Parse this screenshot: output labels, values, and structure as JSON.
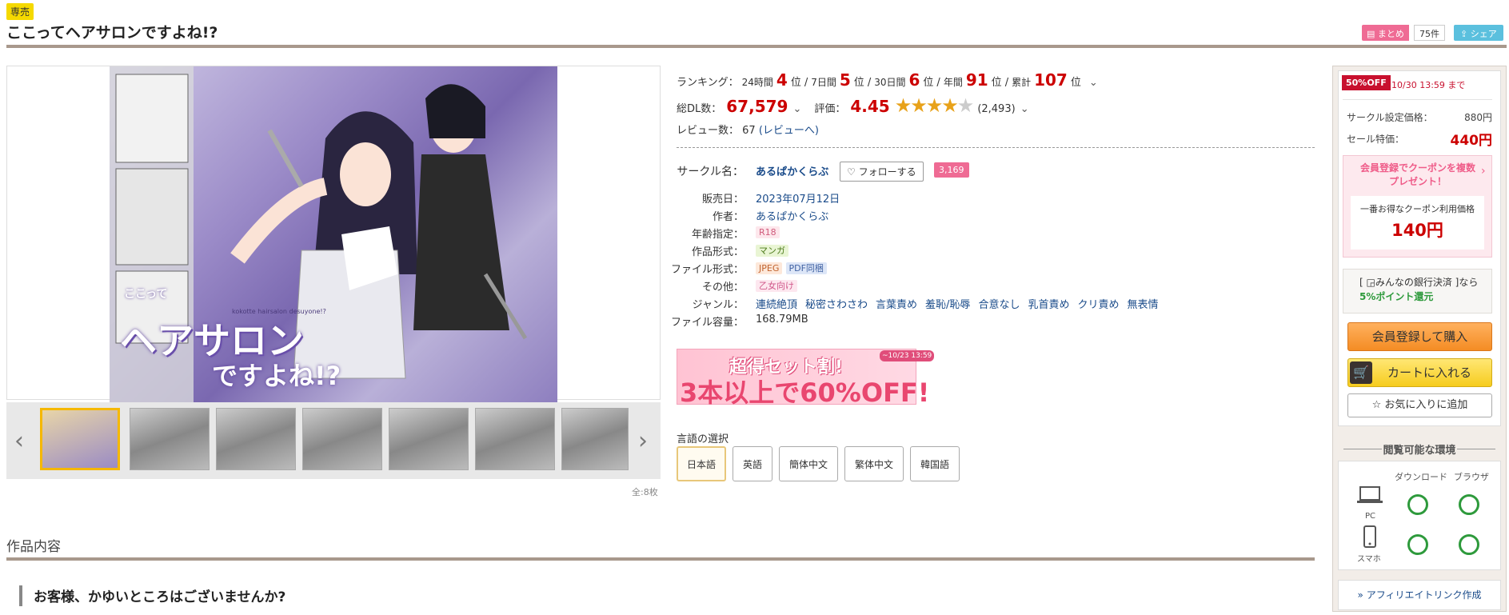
{
  "header": {
    "exclusive_badge": "専売",
    "title": "ここってヘアサロンですよね!?",
    "matome_label": "まとめ",
    "matome_count": "75件",
    "share_label": "シェア"
  },
  "gallery": {
    "cover_title_line1": "ヘアサロン",
    "cover_title_line2": "ですよね!?",
    "cover_top": "ここって",
    "cover_romaji": "kokotte hairsalon desuyone!?",
    "count_label": "全:8枚",
    "prev_icon": "chevron-left-icon",
    "next_icon": "chevron-right-icon"
  },
  "ranking": {
    "label": "ランキング：",
    "items": [
      {
        "period": "24時間",
        "rank": "4",
        "unit": "位"
      },
      {
        "period": "7日間",
        "rank": "5",
        "unit": "位"
      },
      {
        "period": "30日間",
        "rank": "6",
        "unit": "位"
      },
      {
        "period": "年間",
        "rank": "91",
        "unit": "位"
      },
      {
        "period": "累計",
        "rank": "107",
        "unit": "位"
      }
    ]
  },
  "stats": {
    "dl_label": "総DL数：",
    "dl_count": "67,579",
    "rating_label": "評価：",
    "rating_value": "4.45",
    "rating_count": "(2,493)",
    "rating_stars": 4.45,
    "review_label": "レビュー数：",
    "review_count": "67",
    "review_link": "(レビューへ)"
  },
  "details": {
    "circle_label": "サークル名：",
    "circle_name": "あるぱかくらぶ",
    "follow_label": "フォローする",
    "follow_count": "3,169",
    "release_label": "販売日：",
    "release_date": "2023年07月12日",
    "author_label": "作者：",
    "author": "あるぱかくらぶ",
    "age_label": "年齢指定：",
    "age": "R18",
    "format_label": "作品形式：",
    "format": "マンガ",
    "file_label": "ファイル形式：",
    "file_jpeg": "JPEG",
    "file_pdf": "PDF同梱",
    "other_label": "その他：",
    "other": "乙女向け",
    "genre_label": "ジャンル：",
    "genres": [
      "連続絶頂",
      "秘密さわさわ",
      "言葉責め",
      "羞恥/恥辱",
      "合意なし",
      "乳首責め",
      "クリ責め",
      "無表情"
    ],
    "size_label": "ファイル容量：",
    "size": "168.79MB"
  },
  "banner": {
    "line1": "超得セット割!",
    "line2": "3本以上で60%OFF!",
    "date": "~10/23 13:59"
  },
  "language": {
    "label": "言語の選択",
    "options": [
      "日本語",
      "英語",
      "簡体中文",
      "繁体中文",
      "韓国語"
    ]
  },
  "content": {
    "section_title": "作品内容",
    "sub_heading": "お客様、かゆいところはございませんか?"
  },
  "sidebar": {
    "off_badge": "50%OFF",
    "off_until": "10/30 13:59 まで",
    "circle_price_label": "サークル設定価格：",
    "circle_price": "880円",
    "sale_price_label": "セール特価：",
    "sale_price": "440円",
    "coupon_head": "会員登録でクーポンを複数プレゼント！",
    "coupon_label": "一番お得なクーポン利用価格",
    "coupon_price": "140円",
    "bank_text_pre": "[ ",
    "bank_text_main": "みんなの銀行決済",
    "bank_text_post": " ]なら",
    "bank_text_highlight": "5%ポイント還元",
    "buy_label": "会員登録して購入",
    "cart_label": "カートに入れる",
    "fav_label": "お気に入りに追加",
    "env_title": "閲覧可能な環境",
    "env_col_download": "ダウンロード",
    "env_col_browser": "ブラウザ",
    "env_pc": "PC",
    "env_phone": "スマホ",
    "affiliate_label": "» アフィリエイトリンク作成"
  },
  "colors": {
    "accent_red": "#cc0000",
    "link": "#1a4b8a",
    "pink": "#ef6b94",
    "ok_green": "#2e9a3c"
  }
}
